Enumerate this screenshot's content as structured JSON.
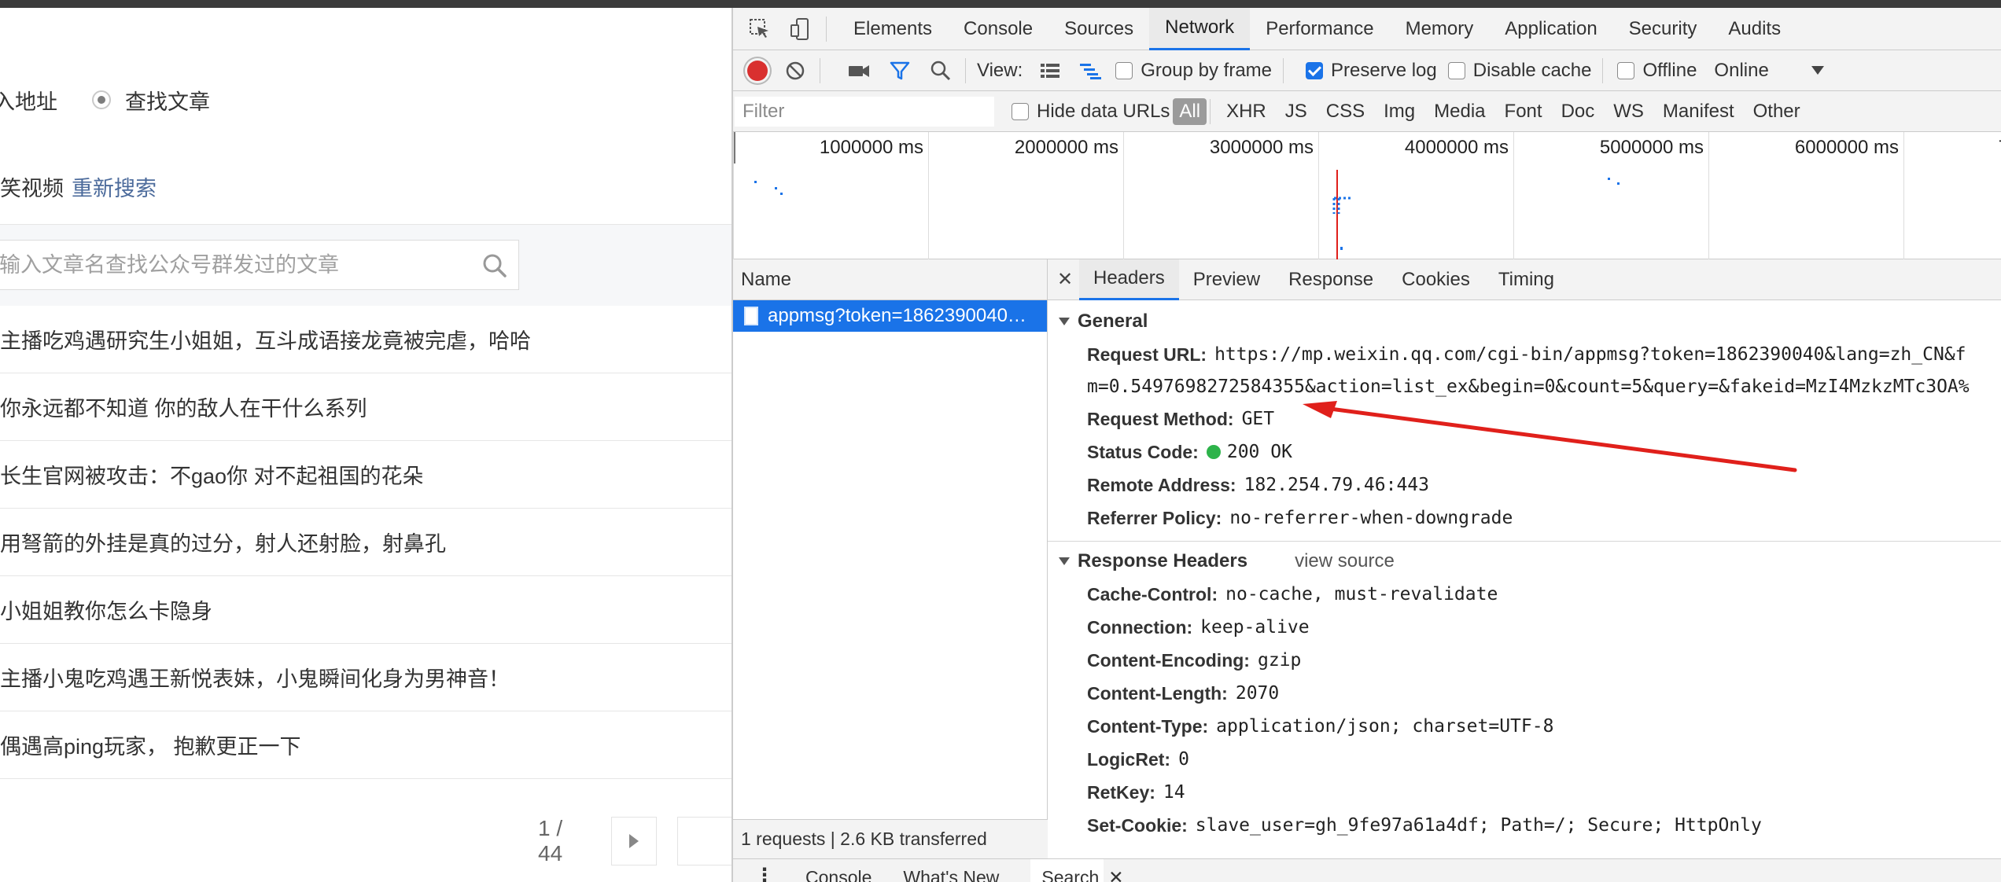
{
  "page": {
    "radio_option_1": "入地址",
    "radio_option_2": "查找文章",
    "result_text": "笑视频",
    "result_link": "重新搜索",
    "search_placeholder": "输入文章名查找公众号群发过的文章",
    "articles": [
      "主播吃鸡遇研究生小姐姐，互斗成语接龙竟被完虐，哈哈",
      "你永远都不知道 你的敌人在干什么系列",
      "长生官网被攻击：不gao你 对不起祖国的花朵",
      "用弩箭的外挂是真的过分，射人还射脸，射鼻孔",
      "小姐姐教你怎么卡隐身",
      "主播小鬼吃鸡遇王新悦表妹，小鬼瞬间化身为男神音！",
      "偶遇高ping玩家， 抱歉更正一下"
    ],
    "pager": "1 / 44"
  },
  "devtools": {
    "tabs": [
      "Elements",
      "Console",
      "Sources",
      "Network",
      "Performance",
      "Memory",
      "Application",
      "Security",
      "Audits"
    ],
    "active_tab": "Network",
    "toolbar": {
      "view_label": "View:",
      "group_by_frame": "Group by frame",
      "preserve_log": "Preserve log",
      "disable_cache": "Disable cache",
      "offline": "Offline",
      "throttle": "Online"
    },
    "filter": {
      "placeholder": "Filter",
      "hide_data_urls": "Hide data URLs",
      "types": [
        "All",
        "XHR",
        "JS",
        "CSS",
        "Img",
        "Media",
        "Font",
        "Doc",
        "WS",
        "Manifest",
        "Other"
      ]
    },
    "timeline_ticks": [
      "1000000 ms",
      "2000000 ms",
      "3000000 ms",
      "4000000 ms",
      "5000000 ms",
      "6000000 ms",
      "7"
    ],
    "name_header": "Name",
    "request_name": "appmsg?token=1862390040…",
    "status_bar": "1 requests | 2.6 KB transferred",
    "detail_tabs": [
      "Headers",
      "Preview",
      "Response",
      "Cookies",
      "Timing"
    ],
    "general": {
      "title": "General",
      "request_url_label": "Request URL:",
      "request_url_1": "https://mp.weixin.qq.com/cgi-bin/appmsg?token=1862390040&lang=zh_CN&f",
      "request_url_2": "m=0.5497698272584355&action=list_ex&begin=0&count=5&query=&fakeid=MzI4MzkzMTc3OA%",
      "method_label": "Request Method:",
      "method": "GET",
      "status_label": "Status Code:",
      "status": "200 OK",
      "remote_label": "Remote Address:",
      "remote": "182.254.79.46:443",
      "referrer_label": "Referrer Policy:",
      "referrer": "no-referrer-when-downgrade"
    },
    "response_headers": {
      "title": "Response Headers",
      "view_source": "view source",
      "items": [
        {
          "k": "Cache-Control:",
          "v": "no-cache, must-revalidate"
        },
        {
          "k": "Connection:",
          "v": "keep-alive"
        },
        {
          "k": "Content-Encoding:",
          "v": "gzip"
        },
        {
          "k": "Content-Length:",
          "v": "2070"
        },
        {
          "k": "Content-Type:",
          "v": "application/json; charset=UTF-8"
        },
        {
          "k": "LogicRet:",
          "v": "0"
        },
        {
          "k": "RetKey:",
          "v": "14"
        },
        {
          "k": "Set-Cookie:",
          "v": "slave_user=gh_9fe97a61a4df; Path=/; Secure; HttpOnly"
        }
      ]
    },
    "drawer_tabs": [
      "Console",
      "What's New",
      "Search"
    ]
  },
  "colors": {
    "accent": "#1a73e8",
    "record": "#d9302f",
    "arrow": "#e0201b"
  }
}
